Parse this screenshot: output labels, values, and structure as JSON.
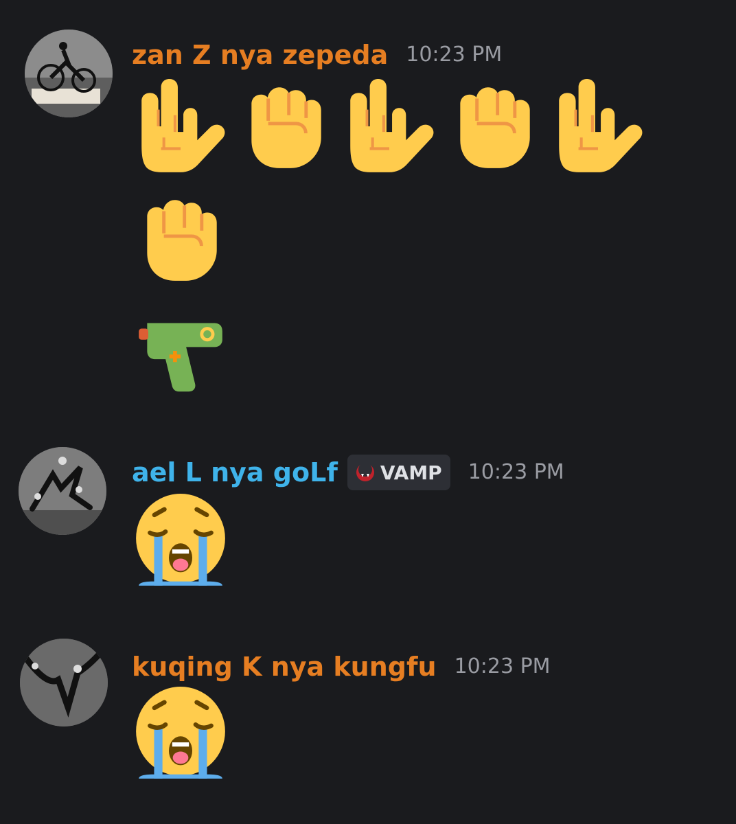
{
  "messages": [
    {
      "username": "zan Z nya zepeda",
      "username_color": "#e67e22",
      "timestamp": "10:23 PM",
      "emoji_rows": [
        [
          "love-you-gesture-icon",
          "raised-fist-icon",
          "love-you-gesture-icon",
          "raised-fist-icon",
          "love-you-gesture-icon"
        ],
        [
          "raised-fist-icon"
        ],
        [
          "water-pistol-icon"
        ]
      ]
    },
    {
      "username": "ael L nya goLf",
      "username_color": "#3fb3ea",
      "tag": {
        "icon": "vamp-fangs-icon",
        "label": "VAMP"
      },
      "timestamp": "10:23 PM",
      "emoji_rows": [
        [
          "loudly-crying-face-icon"
        ]
      ]
    },
    {
      "username": "kuqing K nya kungfu",
      "username_color": "#e67e22",
      "timestamp": "10:23 PM",
      "emoji_rows": [
        [
          "loudly-crying-face-icon"
        ]
      ]
    }
  ],
  "colors": {
    "background": "#1a1b1e",
    "timestamp": "#9a9ca3",
    "tag_background": "#2d2f35"
  }
}
